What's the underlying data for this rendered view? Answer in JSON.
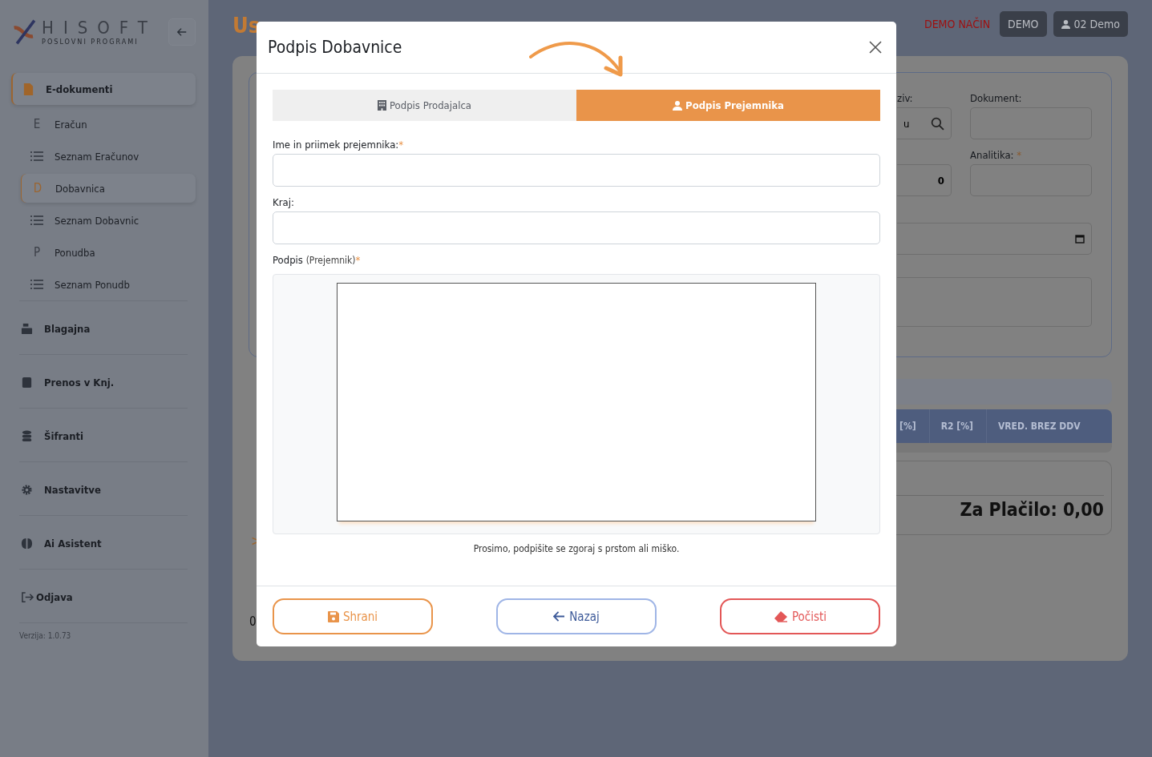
{
  "sidebar": {
    "logo": {
      "name": "HISOFT",
      "tagline": "POSLOVNI PROGRAMI"
    },
    "sections": [
      {
        "label": "E-dokumenti",
        "selected": true,
        "children": [
          {
            "label": "Eračun",
            "kind": "letter",
            "marker": "E",
            "selected": false
          },
          {
            "label": "Seznam Eračunov",
            "kind": "list",
            "selected": false
          },
          {
            "label": "Dobavnica",
            "kind": "letter",
            "marker": "D",
            "selected": true
          },
          {
            "label": "Seznam Dobavnic",
            "kind": "list",
            "selected": false
          },
          {
            "label": "Ponudba",
            "kind": "letter",
            "marker": "P",
            "selected": false
          },
          {
            "label": "Seznam Ponudb",
            "kind": "list",
            "selected": false
          }
        ]
      },
      {
        "label": "Blagajna",
        "selected": false
      },
      {
        "label": "Prenos v Knj.",
        "selected": false
      },
      {
        "label": "Šifranti",
        "selected": false
      },
      {
        "label": "Nastavitve",
        "selected": false
      },
      {
        "label": "Ai Asistent",
        "selected": false
      },
      {
        "label": "Odjava",
        "selected": false
      }
    ],
    "version": "Verzija: 1.0.73"
  },
  "header": {
    "mode": "DEMO NAČIN",
    "badge": "DEMO",
    "user": "02 Demo"
  },
  "page": {
    "title": "Us",
    "naziv_label": "ziv:",
    "search_value": "u",
    "number_value": "0",
    "dokument_label": "Dokument:",
    "analitika_label": "Analitika:",
    "analitika_mark": "*",
    "table_columns": [
      "[%]",
      "R2 [%]",
      "VRED. BREZ DDV"
    ],
    "total": "Za Plačilo: 0,00",
    "chevron": ">",
    "bottom_value": "0"
  },
  "modal": {
    "title": "Podpis Dobavnice",
    "tabs": [
      {
        "label": "Podpis Prodajalca",
        "selected": false
      },
      {
        "label": "Podpis Prejemnika",
        "selected": true
      }
    ],
    "fields": [
      {
        "label": "Ime in priimek prejemnika:",
        "mark": "*"
      },
      {
        "label": "Kraj:"
      }
    ],
    "signature": {
      "label": "Podpis",
      "note": "(Prejemnik)",
      "mark": "*"
    },
    "hint": "Prosimo, podpišite se zgoraj s prstom ali miško.",
    "buttons": [
      {
        "label": "Shrani",
        "kind": "save"
      },
      {
        "label": "Nazaj",
        "kind": "back"
      },
      {
        "label": "Počisti",
        "kind": "clear"
      }
    ]
  }
}
